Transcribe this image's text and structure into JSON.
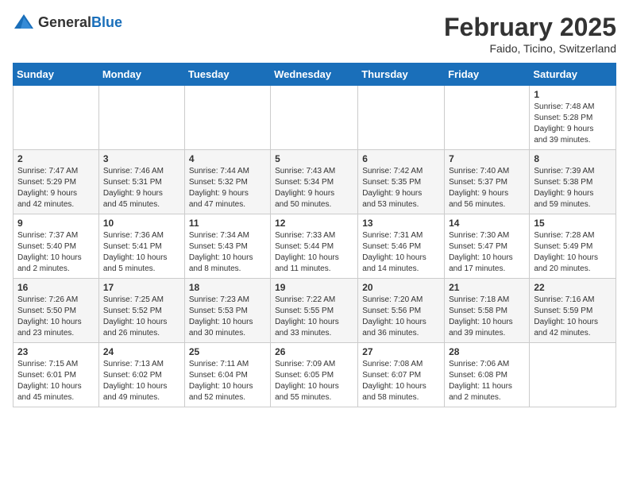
{
  "header": {
    "logo": {
      "text_general": "General",
      "text_blue": "Blue"
    },
    "month_title": "February 2025",
    "subtitle": "Faido, Ticino, Switzerland"
  },
  "calendar": {
    "days_of_week": [
      "Sunday",
      "Monday",
      "Tuesday",
      "Wednesday",
      "Thursday",
      "Friday",
      "Saturday"
    ],
    "weeks": [
      {
        "days": [
          {
            "num": "",
            "info": ""
          },
          {
            "num": "",
            "info": ""
          },
          {
            "num": "",
            "info": ""
          },
          {
            "num": "",
            "info": ""
          },
          {
            "num": "",
            "info": ""
          },
          {
            "num": "",
            "info": ""
          },
          {
            "num": "1",
            "info": "Sunrise: 7:48 AM\nSunset: 5:28 PM\nDaylight: 9 hours\nand 39 minutes."
          }
        ]
      },
      {
        "days": [
          {
            "num": "2",
            "info": "Sunrise: 7:47 AM\nSunset: 5:29 PM\nDaylight: 9 hours\nand 42 minutes."
          },
          {
            "num": "3",
            "info": "Sunrise: 7:46 AM\nSunset: 5:31 PM\nDaylight: 9 hours\nand 45 minutes."
          },
          {
            "num": "4",
            "info": "Sunrise: 7:44 AM\nSunset: 5:32 PM\nDaylight: 9 hours\nand 47 minutes."
          },
          {
            "num": "5",
            "info": "Sunrise: 7:43 AM\nSunset: 5:34 PM\nDaylight: 9 hours\nand 50 minutes."
          },
          {
            "num": "6",
            "info": "Sunrise: 7:42 AM\nSunset: 5:35 PM\nDaylight: 9 hours\nand 53 minutes."
          },
          {
            "num": "7",
            "info": "Sunrise: 7:40 AM\nSunset: 5:37 PM\nDaylight: 9 hours\nand 56 minutes."
          },
          {
            "num": "8",
            "info": "Sunrise: 7:39 AM\nSunset: 5:38 PM\nDaylight: 9 hours\nand 59 minutes."
          }
        ]
      },
      {
        "days": [
          {
            "num": "9",
            "info": "Sunrise: 7:37 AM\nSunset: 5:40 PM\nDaylight: 10 hours\nand 2 minutes."
          },
          {
            "num": "10",
            "info": "Sunrise: 7:36 AM\nSunset: 5:41 PM\nDaylight: 10 hours\nand 5 minutes."
          },
          {
            "num": "11",
            "info": "Sunrise: 7:34 AM\nSunset: 5:43 PM\nDaylight: 10 hours\nand 8 minutes."
          },
          {
            "num": "12",
            "info": "Sunrise: 7:33 AM\nSunset: 5:44 PM\nDaylight: 10 hours\nand 11 minutes."
          },
          {
            "num": "13",
            "info": "Sunrise: 7:31 AM\nSunset: 5:46 PM\nDaylight: 10 hours\nand 14 minutes."
          },
          {
            "num": "14",
            "info": "Sunrise: 7:30 AM\nSunset: 5:47 PM\nDaylight: 10 hours\nand 17 minutes."
          },
          {
            "num": "15",
            "info": "Sunrise: 7:28 AM\nSunset: 5:49 PM\nDaylight: 10 hours\nand 20 minutes."
          }
        ]
      },
      {
        "days": [
          {
            "num": "16",
            "info": "Sunrise: 7:26 AM\nSunset: 5:50 PM\nDaylight: 10 hours\nand 23 minutes."
          },
          {
            "num": "17",
            "info": "Sunrise: 7:25 AM\nSunset: 5:52 PM\nDaylight: 10 hours\nand 26 minutes."
          },
          {
            "num": "18",
            "info": "Sunrise: 7:23 AM\nSunset: 5:53 PM\nDaylight: 10 hours\nand 30 minutes."
          },
          {
            "num": "19",
            "info": "Sunrise: 7:22 AM\nSunset: 5:55 PM\nDaylight: 10 hours\nand 33 minutes."
          },
          {
            "num": "20",
            "info": "Sunrise: 7:20 AM\nSunset: 5:56 PM\nDaylight: 10 hours\nand 36 minutes."
          },
          {
            "num": "21",
            "info": "Sunrise: 7:18 AM\nSunset: 5:58 PM\nDaylight: 10 hours\nand 39 minutes."
          },
          {
            "num": "22",
            "info": "Sunrise: 7:16 AM\nSunset: 5:59 PM\nDaylight: 10 hours\nand 42 minutes."
          }
        ]
      },
      {
        "days": [
          {
            "num": "23",
            "info": "Sunrise: 7:15 AM\nSunset: 6:01 PM\nDaylight: 10 hours\nand 45 minutes."
          },
          {
            "num": "24",
            "info": "Sunrise: 7:13 AM\nSunset: 6:02 PM\nDaylight: 10 hours\nand 49 minutes."
          },
          {
            "num": "25",
            "info": "Sunrise: 7:11 AM\nSunset: 6:04 PM\nDaylight: 10 hours\nand 52 minutes."
          },
          {
            "num": "26",
            "info": "Sunrise: 7:09 AM\nSunset: 6:05 PM\nDaylight: 10 hours\nand 55 minutes."
          },
          {
            "num": "27",
            "info": "Sunrise: 7:08 AM\nSunset: 6:07 PM\nDaylight: 10 hours\nand 58 minutes."
          },
          {
            "num": "28",
            "info": "Sunrise: 7:06 AM\nSunset: 6:08 PM\nDaylight: 11 hours\nand 2 minutes."
          },
          {
            "num": "",
            "info": ""
          }
        ]
      }
    ]
  }
}
